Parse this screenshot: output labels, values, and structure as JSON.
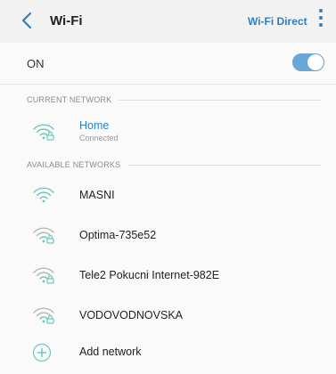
{
  "header": {
    "title": "Wi-Fi",
    "wifi_direct": "Wi-Fi Direct"
  },
  "toggle_row": {
    "label": "ON",
    "enabled": true
  },
  "current_network": {
    "section_title": "CURRENT NETWORK",
    "network": {
      "name": "Home",
      "status": "Connected",
      "icon": "wifi-secured-icon"
    }
  },
  "available_networks": {
    "section_title": "AVAILABLE NETWORKS",
    "items": [
      {
        "name": "MASNI",
        "icon": "wifi-open-icon"
      },
      {
        "name": "Optima-735e52",
        "icon": "wifi-secured-icon"
      },
      {
        "name": "Tele2 Pokucni Internet-982E",
        "icon": "wifi-secured-icon"
      },
      {
        "name": "VODOVODNOVSKA",
        "icon": "wifi-secured-icon"
      }
    ]
  },
  "add_network": {
    "label": "Add network",
    "icon": "plus-icon"
  },
  "colors": {
    "accent": "#2f7fbf",
    "icon_teal": "#6fc7c0",
    "icon_gray": "#b8b8b8"
  }
}
